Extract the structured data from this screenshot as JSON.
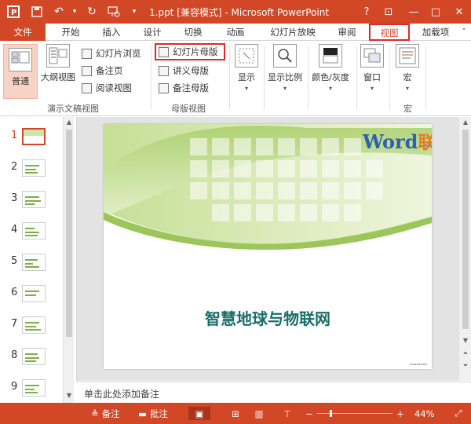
{
  "app": {
    "title": "1.ppt [兼容模式] - Microsoft PowerPoint"
  },
  "quick_access": {
    "undo_icon": "undo-icon",
    "redo_icon": "redo-icon",
    "save_icon": "save-icon"
  },
  "window_buttons": {
    "help": "?",
    "ribbon_options": "⊡",
    "minimize": "—",
    "restore": "□",
    "close": "✕"
  },
  "tabs": [
    {
      "label": "文件"
    },
    {
      "label": "开始"
    },
    {
      "label": "插入"
    },
    {
      "label": "设计"
    },
    {
      "label": "切换"
    },
    {
      "label": "动画"
    },
    {
      "label": "幻灯片放映"
    },
    {
      "label": "审阅"
    },
    {
      "label": "视图"
    },
    {
      "label": "加载项"
    }
  ],
  "ribbon": {
    "presentation_views": {
      "group_label": "演示文稿视图",
      "normal": "普通",
      "outline": "大纲视图",
      "slide_sorter": "幻灯片浏览",
      "notes_page": "备注页",
      "reading_view": "阅读视图"
    },
    "master_views": {
      "group_label": "母版视图",
      "slide_master": "幻灯片母版",
      "handout_master": "讲义母版",
      "notes_master": "备注母版"
    },
    "show": "显示",
    "zoom": "显示比例",
    "color_grayscale": "颜色/灰度",
    "window": "窗口",
    "macros": "宏",
    "macros_group_label": "宏"
  },
  "thumbnails": [
    "1",
    "2",
    "3",
    "4",
    "5",
    "6",
    "7",
    "8",
    "9"
  ],
  "slide": {
    "title": "智慧地球与物联网",
    "watermark_word": "Word",
    "watermark_cn": "联盟",
    "watermark_url": "www.wordlm.com"
  },
  "notes_placeholder": "单击此处添加备注",
  "status": {
    "notes": "备注",
    "comments": "批注",
    "zoom_percent": "44%",
    "zoom_minus": "−",
    "zoom_plus": "+"
  },
  "colors": {
    "accent": "#d24726",
    "highlight_box": "#e0292a",
    "title_teal": "#1a6e6a"
  }
}
